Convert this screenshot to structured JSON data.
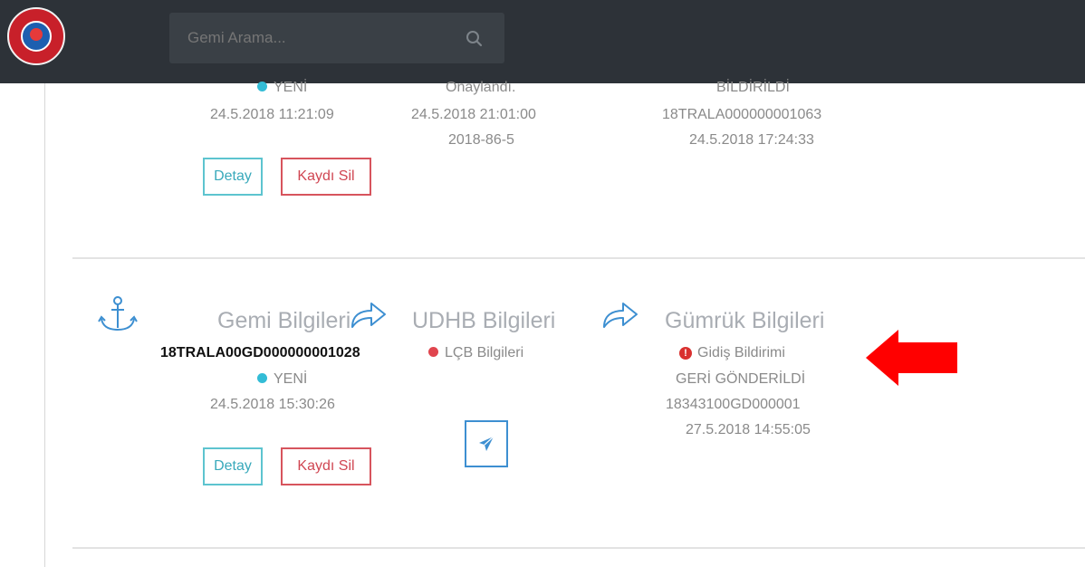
{
  "header": {
    "search_placeholder": "Gemi Arama..."
  },
  "row1": {
    "status": "YENİ",
    "created": "24.5.2018 11:21:09",
    "udhb_status": "Onaylandı.",
    "udhb_date": "24.5.2018 21:01:00",
    "udhb_ref": "2018-86-5",
    "customs_status": "BİLDİRİLDİ",
    "customs_ref": "18TRALA000000001063",
    "customs_date": "24.5.2018 17:24:33",
    "detail_label": "Detay",
    "delete_label": "Kaydı Sil"
  },
  "row2": {
    "ship_title": "Gemi Bilgileri",
    "udhb_title": "UDHB Bilgileri",
    "customs_title": "Gümrük Bilgileri",
    "vessel_id": "18TRALA00GD000000001028",
    "lcb_label": "LÇB Bilgileri",
    "status": "YENİ",
    "created": "24.5.2018 15:30:26",
    "customs_doc": "Gidiş Bildirimi",
    "customs_status": "GERİ GÖNDERİLDİ",
    "customs_ref": "18343100GD000001",
    "customs_date": "27.5.2018 14:55:05",
    "detail_label": "Detay",
    "delete_label": "Kaydı Sil"
  },
  "icons": {
    "anchor": "anchor-icon",
    "share": "share-arrow-icon",
    "send": "paper-plane-icon",
    "search": "search-icon",
    "warning": "exclamation-circle-icon",
    "annotation": "red-arrow-left"
  },
  "colors": {
    "topbar": "#2d3238",
    "accent_blue": "#3d8fd1",
    "status_cyan": "#33bcd6",
    "status_red": "#e0454e",
    "annotation_red": "#ff0000"
  }
}
